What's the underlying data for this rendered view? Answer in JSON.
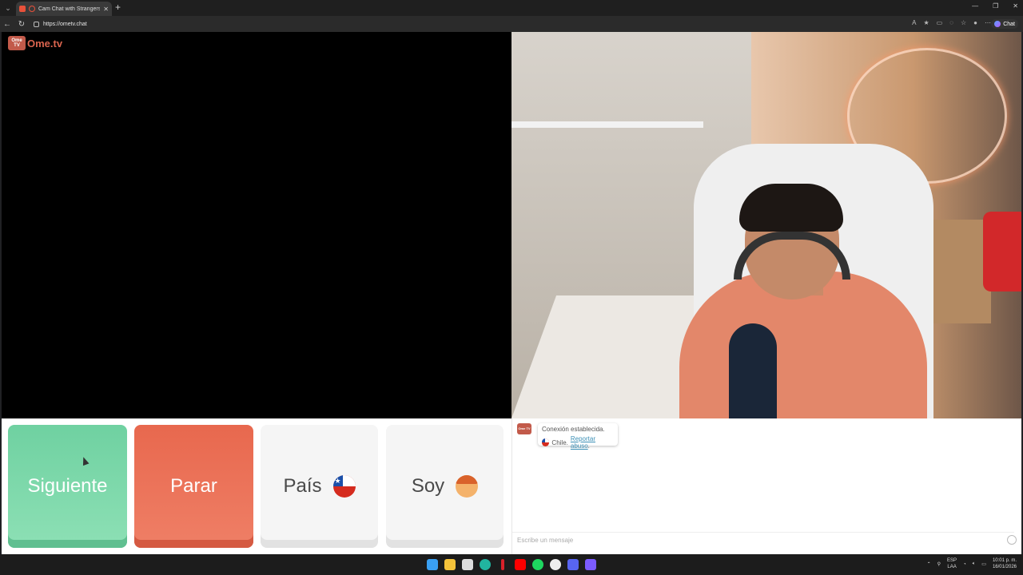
{
  "browser": {
    "tab_title": "Cam Chat with Strangers on O",
    "tab_close": "✕",
    "new_tab": "+",
    "url": "https://ometv.chat",
    "chat_label": "Chat"
  },
  "site": {
    "logo_box": "Ome TV",
    "logo_text": "Ome.tv"
  },
  "controls": {
    "next_label": "Siguiente",
    "stop_label": "Parar",
    "country_label": "País",
    "gender_label": "Soy"
  },
  "chat": {
    "logo_box": "Ome TV",
    "status": "Conexión establecida.",
    "country": "Chile.",
    "report": "Reportar abuso",
    "report_suffix": ".",
    "input_placeholder": "Escribe un mensaje"
  },
  "taskbar": {
    "lang_1": "ESP",
    "lang_2": "LAA",
    "time": "10:01 p. m.",
    "date": "16/01/2026"
  }
}
